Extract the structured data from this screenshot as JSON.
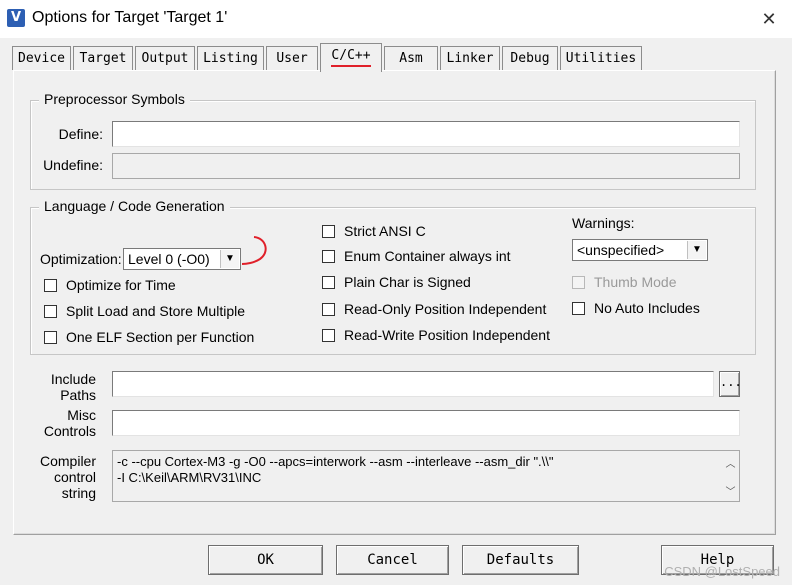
{
  "window": {
    "title": "Options for Target 'Target 1'",
    "app_icon": "keil-uv-icon",
    "close": "✕"
  },
  "tabs": [
    {
      "label": "Device"
    },
    {
      "label": "Target"
    },
    {
      "label": "Output"
    },
    {
      "label": "Listing"
    },
    {
      "label": "User"
    },
    {
      "label": "C/C++"
    },
    {
      "label": "Asm"
    },
    {
      "label": "Linker"
    },
    {
      "label": "Debug"
    },
    {
      "label": "Utilities"
    }
  ],
  "active_tab": "C/C++",
  "preprocessor": {
    "title": "Preprocessor Symbols",
    "define_label": "Define:",
    "define_value": "",
    "undefine_label": "Undefine:",
    "undefine_value": ""
  },
  "language": {
    "title": "Language / Code Generation",
    "optimization_label": "Optimization:",
    "optimization_value": "Level 0 (-O0)",
    "left_checks": [
      {
        "label": "Optimize for Time",
        "checked": false
      },
      {
        "label": "Split Load and Store Multiple",
        "checked": false
      },
      {
        "label": "One ELF Section per Function",
        "checked": false
      }
    ],
    "middle_checks": [
      {
        "label": "Strict ANSI C",
        "checked": false
      },
      {
        "label": "Enum Container always int",
        "checked": false
      },
      {
        "label": "Plain Char is Signed",
        "checked": false
      },
      {
        "label": "Read-Only Position Independent",
        "checked": false
      },
      {
        "label": "Read-Write Position Independent",
        "checked": false
      }
    ],
    "warnings_label": "Warnings:",
    "warnings_value": "<unspecified>",
    "thumb_mode": {
      "label": "Thumb Mode",
      "checked": false,
      "disabled": true
    },
    "no_auto_includes": {
      "label": "No Auto Includes",
      "checked": false
    }
  },
  "include_paths": {
    "label_1": "Include",
    "label_2": "Paths",
    "value": "",
    "browse": "..."
  },
  "misc_controls": {
    "label_1": "Misc",
    "label_2": "Controls",
    "value": ""
  },
  "compiler_control": {
    "label_1": "Compiler",
    "label_2": "control",
    "label_3": "string",
    "line_1": "-c --cpu Cortex-M3 -g -O0 --apcs=interwork --asm --interleave --asm_dir \".\\\\\"",
    "line_2": "-I C:\\Keil\\ARM\\RV31\\INC"
  },
  "buttons": {
    "ok": "OK",
    "cancel": "Cancel",
    "defaults": "Defaults",
    "help": "Help"
  },
  "watermark": "CSDN @LostSpeed",
  "colors": {
    "annotation_red": "#e0202a",
    "icon_blue": "#2d5fb3"
  }
}
